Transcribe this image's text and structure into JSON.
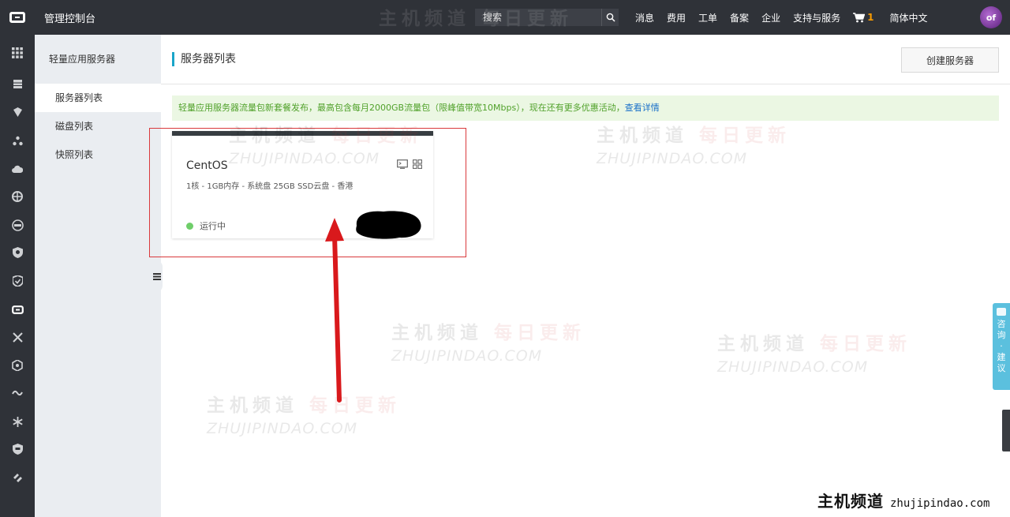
{
  "header": {
    "console_title": "管理控制台",
    "search_placeholder": "搜索",
    "nav": [
      "消息",
      "费用",
      "工单",
      "备案",
      "企业",
      "支持与服务"
    ],
    "cart_count": "1",
    "language": "简体中文",
    "avatar_text": "of"
  },
  "sidebar": {
    "title": "轻量应用服务器",
    "items": [
      "服务器列表",
      "磁盘列表",
      "快照列表"
    ],
    "active_index": 0
  },
  "page": {
    "title": "服务器列表",
    "create_button": "创建服务器"
  },
  "notice": {
    "text": "轻量应用服务器流量包新套餐发布，最高包含每月2000GB流量包（限峰值带宽10Mbps），现在还有更多优惠活动，",
    "link": "查看详情"
  },
  "server": {
    "os": "CentOS",
    "specs": "1核 - 1GB内存 - 系统盘 25GB SSD云盘 - 香港",
    "status": "运行中",
    "status_color": "#6fce6a"
  },
  "feedback": {
    "chars": [
      "咨",
      "询",
      "·",
      "建",
      "议"
    ]
  },
  "watermark": {
    "cn_grey": "主机频道",
    "cn_red": "每日更新",
    "en": "ZHUJIPINDAO.COM"
  },
  "brand": {
    "cn": "主机频道",
    "en": "zhujipindao.com"
  },
  "colors": {
    "topbar": "#2f3238",
    "accent": "#1aa5c9",
    "highlight": "#d9393c"
  }
}
